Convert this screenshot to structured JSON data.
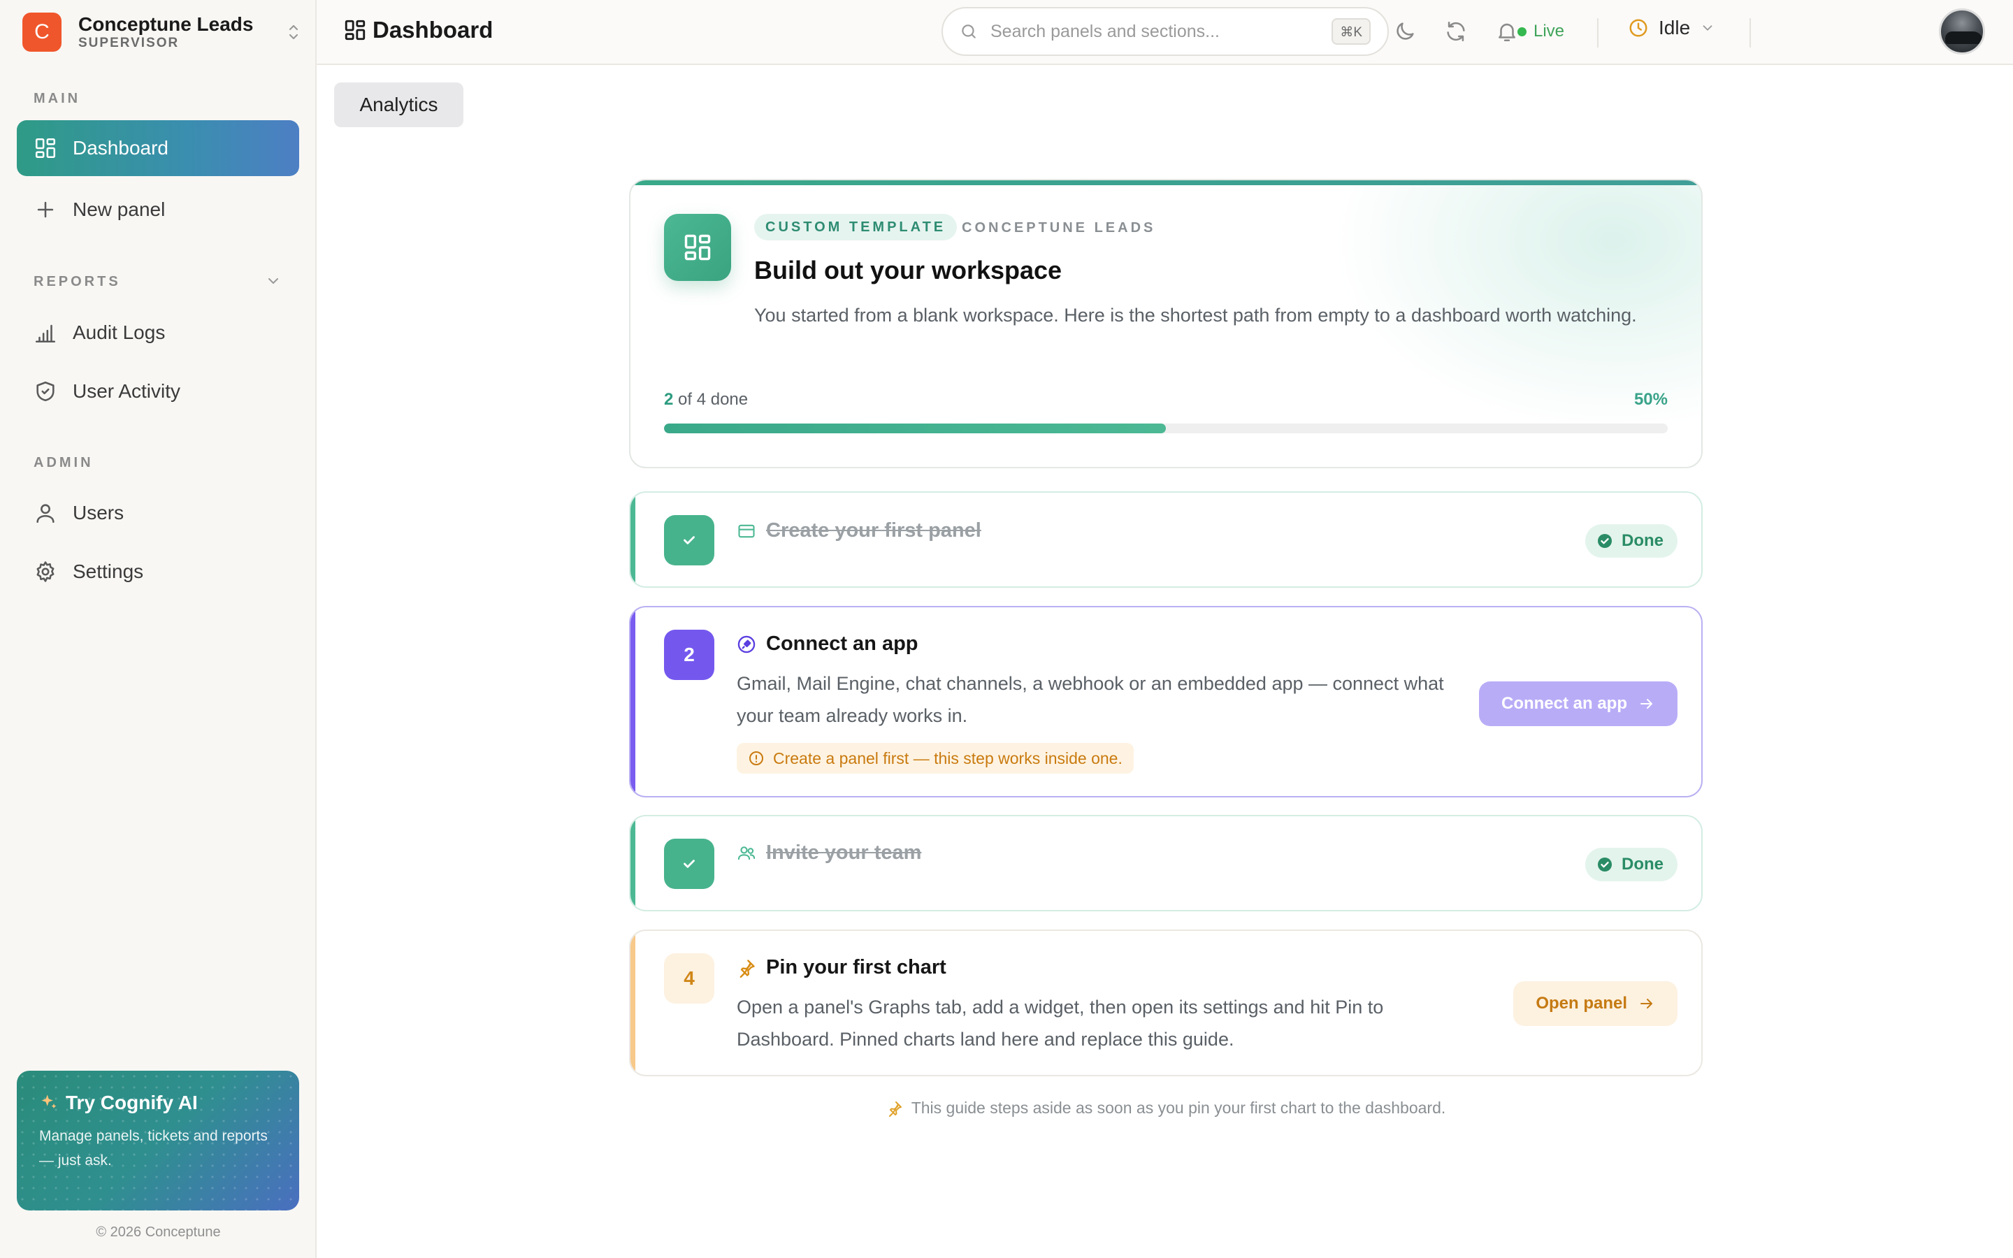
{
  "brand": {
    "initial": "C",
    "name": "Conceptune Leads",
    "role": "SUPERVISOR"
  },
  "sidebar": {
    "sections": [
      {
        "label": "MAIN"
      },
      {
        "label": "REPORTS"
      },
      {
        "label": "ADMIN"
      }
    ],
    "items": [
      {
        "label": "Dashboard",
        "icon": "dashboard-grid-icon",
        "active": true
      },
      {
        "label": "New panel",
        "icon": "plus-icon"
      },
      {
        "label": "Audit Logs",
        "icon": "bar-chart-icon"
      },
      {
        "label": "User Activity",
        "icon": "shield-icon"
      },
      {
        "label": "Users",
        "icon": "user-icon"
      },
      {
        "label": "Settings",
        "icon": "gear-icon"
      }
    ],
    "promo": {
      "title": "Try Cognify AI",
      "text": "Manage panels, tickets and reports — just ask."
    },
    "copyright": "© 2026 Conceptune"
  },
  "topbar": {
    "title": "Dashboard",
    "search": {
      "placeholder": "Search panels and sections...",
      "shortcut": "⌘K"
    },
    "live_label": "Live",
    "status_label": "Idle",
    "colors": {
      "live": "#35b84f",
      "idle": "#e09a1f"
    }
  },
  "main": {
    "tab": "Analytics",
    "hero": {
      "tag": "CUSTOM TEMPLATE",
      "org": "CONCEPTUNE LEADS",
      "title": "Build out your workspace",
      "description": "You started from a blank workspace. Here is the shortest path from empty to a dashboard worth watching.",
      "progress": {
        "done": "2",
        "total_text": "of 4 done",
        "percent_label": "50%",
        "fraction": 0.5
      }
    },
    "steps": [
      {
        "number": "",
        "title": "Create your first panel",
        "status": "Done"
      },
      {
        "number": "2",
        "title": "Connect an app",
        "description": "Gmail, Mail Engine, chat channels, a webhook or an embedded app — connect what your team already works in.",
        "warning": "Create a panel first — this step works inside one.",
        "action": "Connect an app"
      },
      {
        "number": "",
        "title": "Invite your team",
        "status": "Done"
      },
      {
        "number": "4",
        "title": "Pin your first chart",
        "description": "Open a panel's Graphs tab, add a widget, then open its settings and hit Pin to Dashboard. Pinned charts land here and replace this guide.",
        "action": "Open panel"
      }
    ],
    "footnote": "This guide steps aside as soon as you pin your first chart to the dashboard."
  }
}
